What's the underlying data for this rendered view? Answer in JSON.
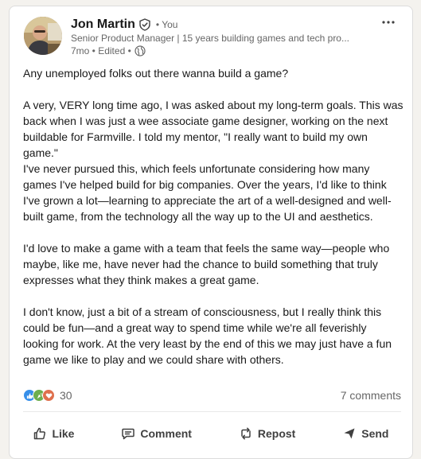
{
  "post": {
    "author": {
      "name": "Jon Martin",
      "relation": "• You",
      "headline": "Senior Product Manager | 15 years building games and tech pro...",
      "meta": "7mo • Edited •"
    },
    "body": {
      "p1": "Any unemployed folks out there wanna build a game?",
      "p2": "A very, VERY long time ago, I was asked about my long-term goals. This was back when I was just a wee associate game designer, working on the next buildable for Farmville. I told my mentor, \"I really want to build my own game.\"",
      "p3": "I've never pursued this, which feels unfortunate considering how many games I've helped build for big companies. Over the years, I'd like to think I've grown a lot—learning to appreciate the art of a well-designed and well-built game, from the technology all the way up to the UI and aesthetics.",
      "p4": "I'd love to make a game with a team that feels the same way—people who maybe, like me, have never had the chance to build something that truly expresses what they think makes a great game.",
      "p5": "I don't know, just a bit of a stream of consciousness, but I really think this could be fun—and a great way to spend time while we're all feverishly looking for work. At the very least by the end of this we may just have a fun game we like to play and we could share with others."
    },
    "social": {
      "reaction_count": "30",
      "comments": "7 comments"
    },
    "actions": {
      "like": "Like",
      "comment": "Comment",
      "repost": "Repost",
      "send": "Send"
    },
    "icons": {
      "verified": "verified-shield-icon",
      "globe": "globe-icon",
      "more": "more-options-icon",
      "reactions": [
        "like-reaction-icon",
        "celebrate-reaction-icon",
        "love-reaction-icon"
      ]
    },
    "colors": {
      "like_reaction": "#378fe9",
      "celebrate_reaction": "#6dae4f",
      "love_reaction": "#df704d"
    }
  }
}
